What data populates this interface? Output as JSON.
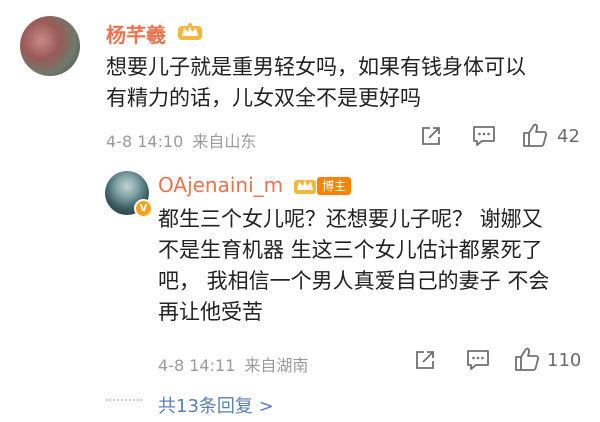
{
  "comment": {
    "username": "杨芊羲",
    "text_line1": "想要儿子就是重男轻女吗，如果有钱身体可以",
    "text_line2": "有精力的话，儿女双全不是更好吗",
    "time": "4-8 14:10",
    "location": "来自山东",
    "like_count": "42"
  },
  "reply": {
    "username": "OAjenaini_m",
    "role_badge": "博主",
    "verified_badge": "V",
    "text_line1": "都生三个女儿呢？还想要儿子呢？ 谢娜又",
    "text_line2": "不是生育机器 生这三个女儿估计都累死了",
    "text_line3": "吧， 我相信一个男人真爱自己的妻子 不会",
    "text_line4": "再让他受苦",
    "time": "4-8 14:11",
    "location": "来自湖南",
    "like_count": "110"
  },
  "more_replies": {
    "label": "共13条回复 >"
  },
  "colors": {
    "username": "#eb7350",
    "link": "#5b7fb2",
    "badge": "#ff8200"
  }
}
